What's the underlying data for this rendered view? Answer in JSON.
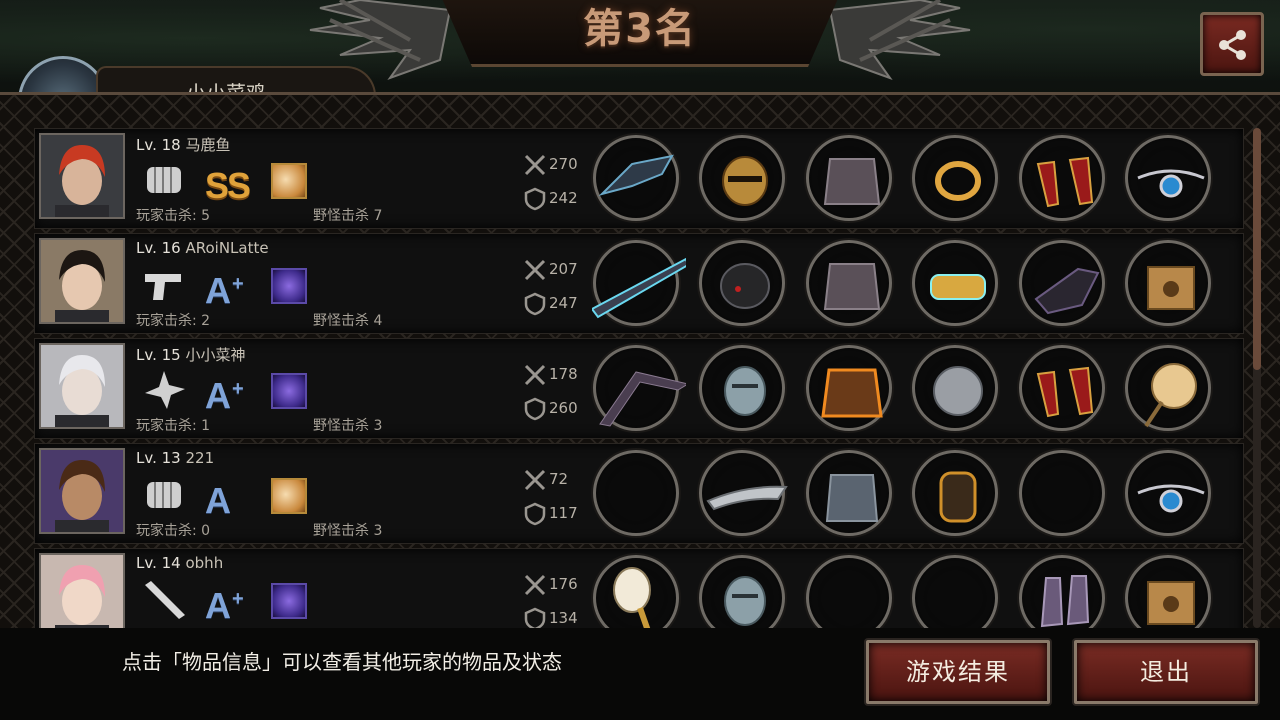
{
  "header": {
    "title": "第3名",
    "player_name_partial": "小小菜鸡"
  },
  "players": [
    {
      "level_label": "Lv. 18",
      "name": "马鹿鱼",
      "weapon_icon": "fist-icon",
      "rank": "SS",
      "rank_plus": "",
      "skill_icon": "gold-skill-icon",
      "attack": "270",
      "defense": "242",
      "player_kills_label": "玩家击杀: 5",
      "monster_kills_label": "野怪击杀 7",
      "items": [
        "dark-claw-weapon-icon",
        "gold-helmet-icon",
        "plate-armor-icon",
        "gold-ring-icon",
        "red-heels-icon",
        "blue-gem-necklace-icon"
      ]
    },
    {
      "level_label": "Lv. 16",
      "name": "ARoiNLatte",
      "weapon_icon": "pistol-icon",
      "rank": "A",
      "rank_plus": "+",
      "skill_icon": "purple-skill-icon",
      "attack": "207",
      "defense": "247",
      "player_kills_label": "玩家击杀: 2",
      "monster_kills_label": "野怪击杀 4",
      "items": [
        "laser-rifle-icon",
        "black-helmet-icon",
        "plate-armor-icon",
        "gold-bracelet-icon",
        "dark-gauntlet-icon",
        "supply-crate-icon"
      ]
    },
    {
      "level_label": "Lv. 15",
      "name": "小小菜神",
      "weapon_icon": "shuriken-icon",
      "rank": "A",
      "rank_plus": "+",
      "skill_icon": "purple-skill-icon",
      "attack": "178",
      "defense": "260",
      "player_kills_label": "玩家击杀: 1",
      "monster_kills_label": "野怪击杀 3",
      "items": [
        "boomerang-icon",
        "knight-helmet-icon",
        "flame-armor-icon",
        "silver-disc-icon",
        "red-heels-icon",
        "paper-fan-icon"
      ]
    },
    {
      "level_label": "Lv. 13",
      "name": "221",
      "weapon_icon": "fist-icon",
      "rank": "A",
      "rank_plus": "",
      "skill_icon": "gold-skill-icon",
      "attack": "72",
      "defense": "117",
      "player_kills_label": "玩家击杀: 0",
      "monster_kills_label": "野怪击杀 3",
      "items": [
        "empty-slot",
        "silver-tiara-icon",
        "chainmail-icon",
        "armguard-icon",
        "empty-slot",
        "blue-gem-necklace-icon"
      ]
    },
    {
      "level_label": "Lv. 14",
      "name": "obhh",
      "weapon_icon": "bat-icon",
      "rank": "A",
      "rank_plus": "+",
      "skill_icon": "purple-skill-icon",
      "attack": "176",
      "defense": "134",
      "player_kills_label": "",
      "monster_kills_label": "",
      "items": [
        "paddle-icon",
        "knight-helmet-icon",
        "empty-slot",
        "empty-slot",
        "purple-boots-icon",
        "supply-crate-icon"
      ]
    }
  ],
  "footer": {
    "hint": "点击「物品信息」可以查看其他玩家的物品及状态",
    "result_button": "游戏结果",
    "exit_button": "退出"
  },
  "colors": {
    "button_red": "#6a2019",
    "rank_gold": "#e0a23a",
    "rank_blue": "#7fa3d8",
    "title": "#c89a78"
  }
}
